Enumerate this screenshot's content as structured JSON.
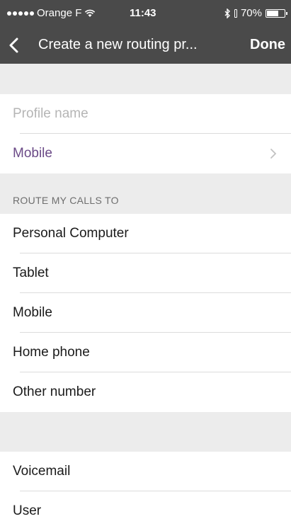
{
  "status_bar": {
    "carrier": "Orange F",
    "time": "11:43",
    "battery_percent": "70%",
    "battery_level": 0.7
  },
  "nav": {
    "title": "Create a new routing pr...",
    "done_label": "Done"
  },
  "profile": {
    "name_placeholder": "Profile name",
    "device_value": "Mobile"
  },
  "route_section": {
    "header": "ROUTE MY CALLS TO",
    "items": [
      {
        "label": "Personal Computer"
      },
      {
        "label": "Tablet"
      },
      {
        "label": "Mobile"
      },
      {
        "label": "Home phone"
      },
      {
        "label": "Other number"
      }
    ]
  },
  "other_section": {
    "items": [
      {
        "label": "Voicemail"
      },
      {
        "label": "User"
      }
    ]
  }
}
